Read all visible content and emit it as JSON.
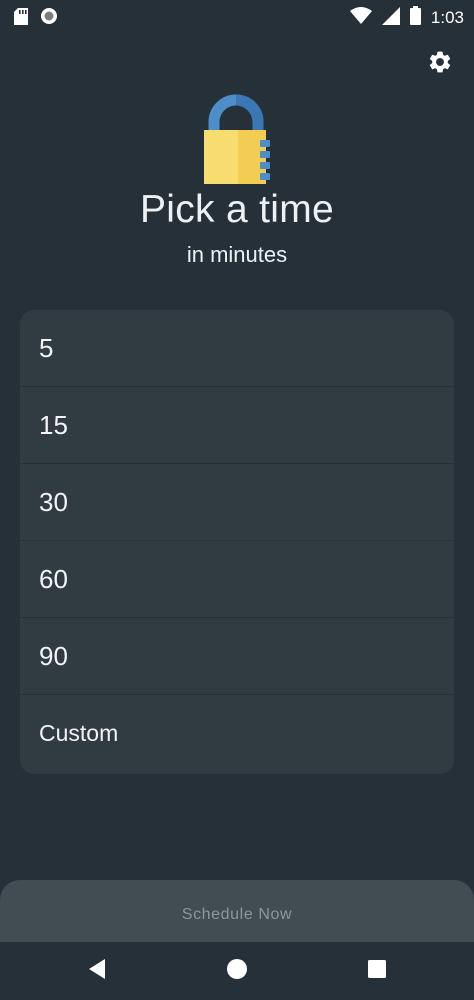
{
  "status_bar": {
    "time": "1:03",
    "icons": [
      "sd-card-icon",
      "circle-notification-icon",
      "wifi-icon",
      "signal-icon",
      "battery-icon"
    ]
  },
  "header": {
    "settings_icon": "gear-icon",
    "lock_icon": "padlock-icon",
    "title": "Pick a time",
    "subtitle": "in minutes"
  },
  "options": [
    {
      "label": "5"
    },
    {
      "label": "15"
    },
    {
      "label": "30"
    },
    {
      "label": "60"
    },
    {
      "label": "90"
    },
    {
      "label": "Custom"
    }
  ],
  "schedule_button": {
    "label": "Schedule Now"
  },
  "nav_bar": {
    "icons": [
      "back-icon",
      "home-icon",
      "recents-icon"
    ]
  },
  "colors": {
    "background": "#263038",
    "card": "#313b42",
    "button": "#424c53",
    "lock_body": "#f7dc6f",
    "lock_shackle": "#4d8dc9"
  }
}
